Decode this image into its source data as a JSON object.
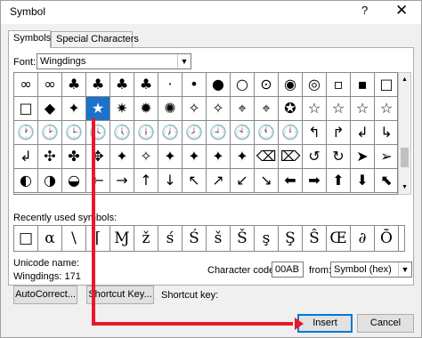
{
  "window": {
    "title": "Symbol",
    "help_glyph": "?",
    "close_glyph": "✕"
  },
  "tabs": [
    {
      "label": "Symbols"
    },
    {
      "label": "Special Characters"
    }
  ],
  "font": {
    "label": "Font:",
    "value": "Wingdings"
  },
  "symbol_grid": {
    "rows": [
      [
        "∞",
        "∞",
        "♣",
        "♣",
        "♣",
        "♣",
        "·",
        "•",
        "●",
        "○",
        "⊙",
        "◉",
        "◎",
        "▫",
        "▪",
        "□"
      ],
      [
        "□",
        "◆",
        "✦",
        "★",
        "✷",
        "✹",
        "✺",
        "✧",
        "✧",
        "⌖",
        "⌖",
        "✪",
        "☆",
        "☆",
        "☆",
        "☆"
      ],
      [
        "🕐",
        "🕑",
        "🕒",
        "🕓",
        "🕔",
        "🕕",
        "🕖",
        "🕗",
        "🕘",
        "🕙",
        "🕚",
        "🕛",
        "↰",
        "↱",
        "↲",
        "↳"
      ],
      [
        "↲",
        "✣",
        "✤",
        "✥",
        "✦",
        "✧",
        "✦",
        "✦",
        "✦",
        "✦",
        "⌫",
        "⌦",
        "↺",
        "↻",
        "➤",
        "➢"
      ],
      [
        "◐",
        "◑",
        "◒",
        "←",
        "→",
        "↑",
        "↓",
        "↖",
        "↗",
        "↙",
        "↘",
        "⬅",
        "➡",
        "⬆",
        "⬇",
        "⬉"
      ]
    ],
    "selected_row": 1,
    "selected_col": 3
  },
  "recent": {
    "label": "Recently used symbols:",
    "symbols": [
      "□",
      "α",
      "\\",
      "⌈",
      "Ɱ",
      "ž",
      "ś",
      "Ś",
      "š",
      "Š",
      "ş",
      "Ş",
      "Ŝ",
      "Œ",
      "∂",
      "Ō"
    ]
  },
  "unicode": {
    "label": "Unicode name:",
    "name": "Wingdings: 171"
  },
  "char_code": {
    "label": "Character code:",
    "value": "00AB"
  },
  "from": {
    "label": "from:",
    "value": "Symbol (hex)"
  },
  "buttons": {
    "autocorrect": "AutoCorrect...",
    "shortcut_key": "Shortcut Key...",
    "insert": "Insert",
    "cancel": "Cancel"
  },
  "shortcut_label": "Shortcut key:",
  "annotation": {
    "arrow_color": "#e8182a"
  }
}
